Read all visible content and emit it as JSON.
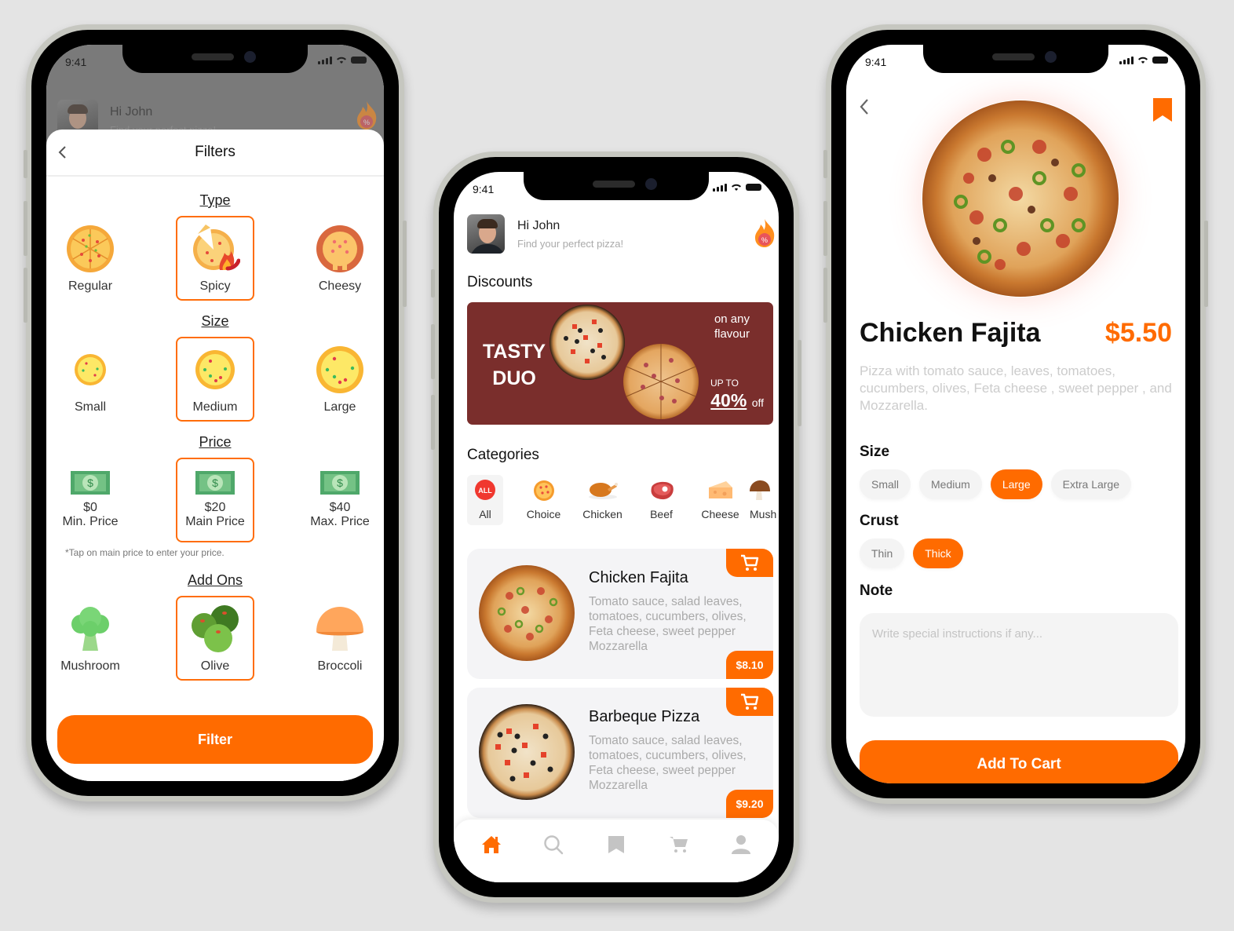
{
  "colors": {
    "accent": "#ff6b00",
    "banner": "#7a2e2c",
    "background": "#e4e4e4"
  },
  "status_bar": {
    "time": "9:41"
  },
  "user": {
    "greeting": "Hi John",
    "subtitle": "Find your perfect pizza!"
  },
  "filters_screen": {
    "title": "Filters",
    "sections": {
      "type": {
        "title": "Type",
        "options": [
          {
            "label": "Regular",
            "selected": false
          },
          {
            "label": "Spicy",
            "selected": true
          },
          {
            "label": "Cheesy",
            "selected": false
          }
        ]
      },
      "size": {
        "title": "Size",
        "options": [
          {
            "label": "Small",
            "selected": false
          },
          {
            "label": "Medium",
            "selected": true
          },
          {
            "label": "Large",
            "selected": false
          }
        ]
      },
      "price": {
        "title": "Price",
        "options": [
          {
            "value": "$0",
            "label": "Min. Price",
            "selected": false
          },
          {
            "value": "$20",
            "label": "Main Price",
            "selected": true
          },
          {
            "value": "$40",
            "label": "Max. Price",
            "selected": false
          }
        ],
        "hint": "*Tap on main price to enter your price."
      },
      "addons": {
        "title": "Add Ons",
        "options": [
          {
            "label": "Mushroom",
            "selected": false
          },
          {
            "label": "Olive",
            "selected": true
          },
          {
            "label": "Broccoli",
            "selected": false
          }
        ]
      }
    },
    "filter_button": "Filter"
  },
  "home_screen": {
    "discounts_title": "Discounts",
    "banner": {
      "line1": "TASTY",
      "line2": "DUO",
      "tag": "on any flavour",
      "tag1": "on any",
      "tag2": "flavour",
      "upto": "UP TO",
      "percent": "40%",
      "off": "off"
    },
    "categories_title": "Categories",
    "categories": [
      {
        "label": "All",
        "icon": "all-badge-icon",
        "active": true,
        "badge": "ALL"
      },
      {
        "label": "Choice",
        "icon": "pizza-icon"
      },
      {
        "label": "Chicken",
        "icon": "roast-chicken-icon"
      },
      {
        "label": "Beef",
        "icon": "steak-icon"
      },
      {
        "label": "Cheese",
        "icon": "cheese-icon"
      },
      {
        "label": "Mushroom",
        "icon": "mushroom-icon",
        "display": "Mush"
      }
    ],
    "items": [
      {
        "name": "Chicken Fajita",
        "description": "Tomato sauce, salad leaves, tomatoes, cucumbers, olives, Feta cheese, sweet pepper Mozzarella",
        "price": "$8.10"
      },
      {
        "name": "Barbeque Pizza",
        "description": "Tomato sauce, salad leaves, tomatoes, cucumbers, olives, Feta cheese, sweet pepper Mozzarella",
        "price": "$9.20"
      }
    ],
    "nav": [
      {
        "name": "home",
        "active": true
      },
      {
        "name": "search"
      },
      {
        "name": "saved"
      },
      {
        "name": "cart"
      },
      {
        "name": "profile"
      }
    ]
  },
  "detail_screen": {
    "name": "Chicken Fajita",
    "price": "$5.50",
    "description": "Pizza with tomato sauce, leaves, tomatoes, cucumbers, olives, Feta cheese , sweet pepper , and Mozzarella.",
    "size_label": "Size",
    "sizes": [
      {
        "label": "Small",
        "selected": false
      },
      {
        "label": "Medium",
        "selected": false
      },
      {
        "label": "Large",
        "selected": true
      },
      {
        "label": "Extra Large",
        "selected": false
      }
    ],
    "crust_label": "Crust",
    "crusts": [
      {
        "label": "Thin",
        "selected": false
      },
      {
        "label": "Thick",
        "selected": true
      }
    ],
    "note_label": "Note",
    "note_placeholder": "Write special instructions if any...",
    "add_button": "Add To Cart"
  }
}
